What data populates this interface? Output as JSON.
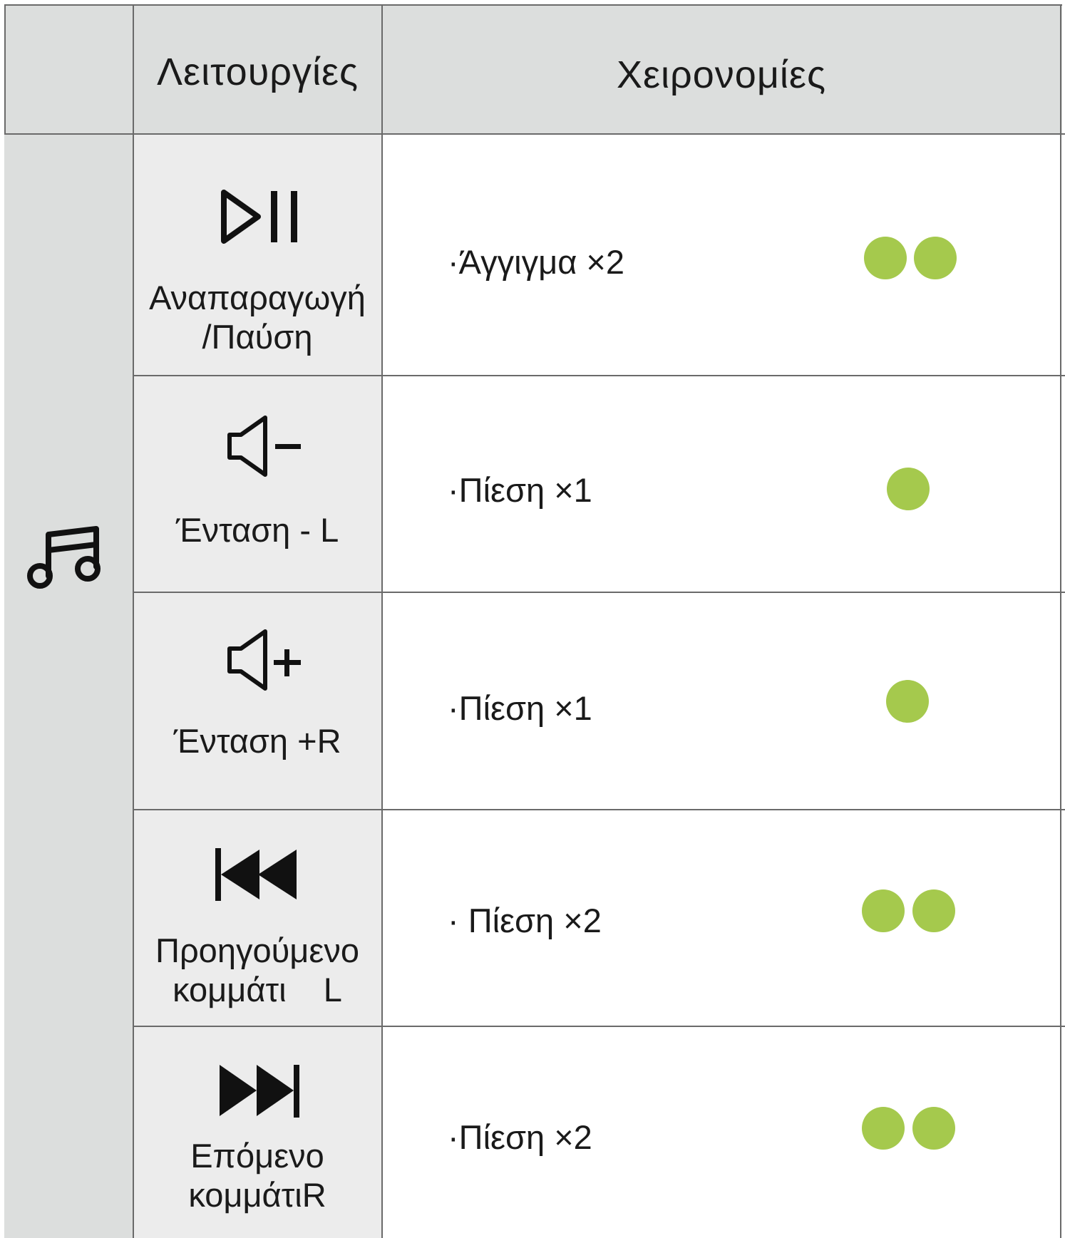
{
  "colors": {
    "header_bg": "#dcdedd",
    "function_bg": "#ececec",
    "gesture_dot": "#a5c94d",
    "border": "#6a6a6a"
  },
  "header": {
    "category": "",
    "functions": "Λειτουργίες",
    "gestures": "Χειρονομίες"
  },
  "category": {
    "icon": "music-note-icon"
  },
  "rows": [
    {
      "icon": "play-pause-icon",
      "label": "Αναπαραγωγή\n/Παύση",
      "gesture": "·Άγγιγμα ×2",
      "dots": 2
    },
    {
      "icon": "volume-down-icon",
      "label": "Ένταση - L",
      "gesture": "·Πίεση ×1",
      "dots": 1
    },
    {
      "icon": "volume-up-icon",
      "label": "Ένταση +R",
      "gesture": "·Πίεση ×1",
      "dots": 1
    },
    {
      "icon": "previous-track-icon",
      "label": "Προηγούμενο\nκομμάτι    L",
      "gesture": "· Πίεση ×2",
      "dots": 2
    },
    {
      "icon": "next-track-icon",
      "label": "Επόμενο\nκομμάτιR",
      "gesture": "·Πίεση ×2",
      "dots": 2
    }
  ]
}
